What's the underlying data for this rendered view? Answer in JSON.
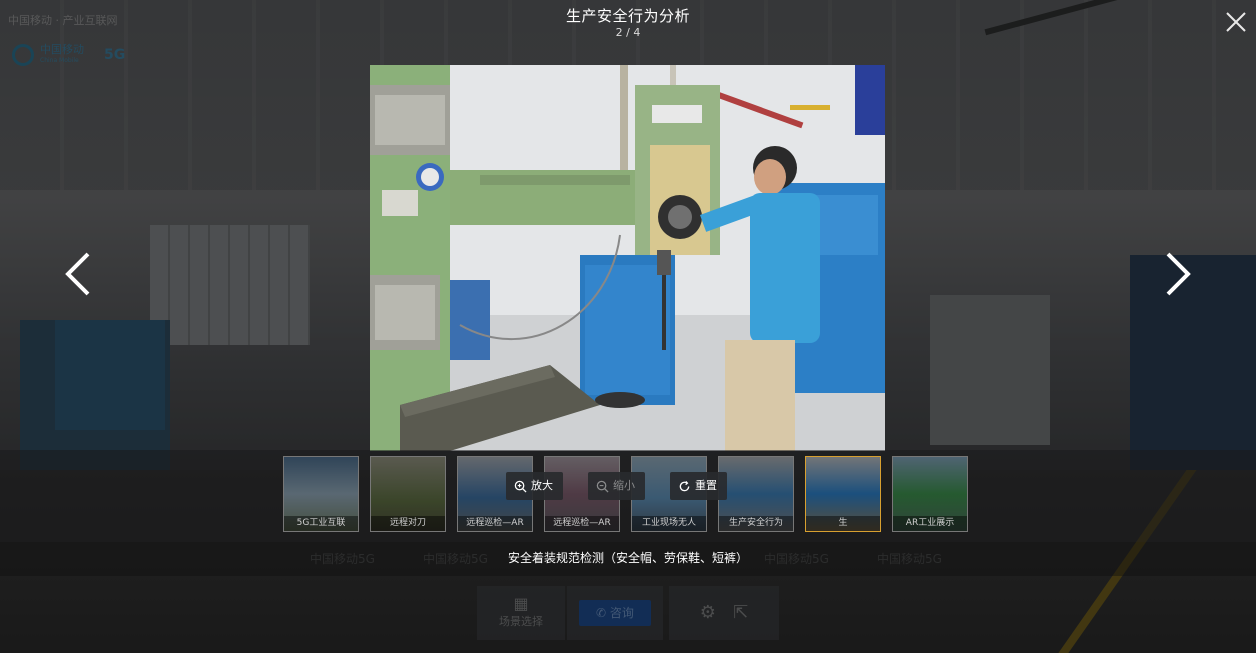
{
  "viewer": {
    "title": "生产安全行为分析",
    "counter": "2 / 4",
    "caption": "安全着装规范检测（安全帽、劳保鞋、短裤）"
  },
  "tools": {
    "zoom_in": "放大",
    "zoom_out": "缩小",
    "reset": "重置"
  },
  "thumbnails": [
    {
      "label": "5G工业互联"
    },
    {
      "label": "远程对刀"
    },
    {
      "label": "远程巡检—AR"
    },
    {
      "label": "远程巡检—AR"
    },
    {
      "label": "工业现场无人"
    },
    {
      "label": "生产安全行为"
    },
    {
      "label": "生"
    },
    {
      "label": "AR工业展示"
    }
  ],
  "background": {
    "breadcrumb": "中国移动 · 产业互联网",
    "logo_text": "中国移动",
    "logo_sub": "China Mobile",
    "logo_5g": "5G",
    "labels": [
      "中国移动5G",
      "中国移动5G",
      "中国移动5G",
      "中国移动5G"
    ],
    "toolbar": {
      "scene_select": "场景选择",
      "consult": "咨询"
    }
  },
  "colors": {
    "accent_active_thumb": "#d8a030",
    "machine_green": "#8bb07a",
    "worker_shirt": "#3aa0d8",
    "cabinet_blue": "#2a7ac0"
  }
}
